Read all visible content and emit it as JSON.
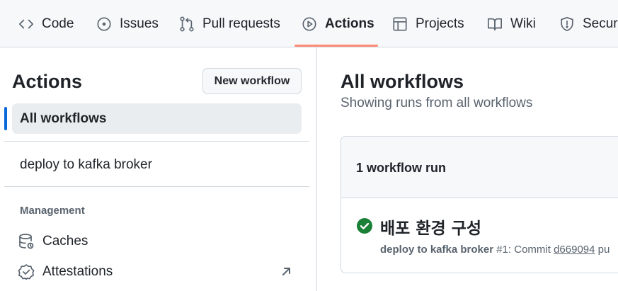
{
  "repo_nav": {
    "tabs": [
      {
        "label": "Code",
        "icon": "code-icon"
      },
      {
        "label": "Issues",
        "icon": "issue-opened-icon"
      },
      {
        "label": "Pull requests",
        "icon": "git-pull-request-icon"
      },
      {
        "label": "Actions",
        "icon": "play-icon",
        "selected": true
      },
      {
        "label": "Projects",
        "icon": "table-icon"
      },
      {
        "label": "Wiki",
        "icon": "book-icon"
      },
      {
        "label": "Security",
        "icon": "shield-icon"
      }
    ],
    "accent_color": "#fd8c73"
  },
  "sidebar": {
    "title": "Actions",
    "new_workflow_label": "New workflow",
    "selected_item": "All workflows",
    "workflows": [
      "deploy to kafka broker"
    ],
    "management_heading": "Management",
    "management_items": [
      {
        "label": "Caches",
        "icon": "database-icon"
      },
      {
        "label": "Attestations",
        "icon": "verified-icon",
        "external": true
      }
    ]
  },
  "main": {
    "title": "All workflows",
    "subtitle": "Showing runs from all workflows",
    "runs_count": "1 workflow run",
    "runs": [
      {
        "status": "success",
        "status_color": "#1a7f37",
        "title": "배포 환경 구성",
        "workflow": "deploy to kafka broker",
        "run_number": "#1: Commit",
        "commit": "d669094",
        "trailing": "pu"
      }
    ]
  }
}
